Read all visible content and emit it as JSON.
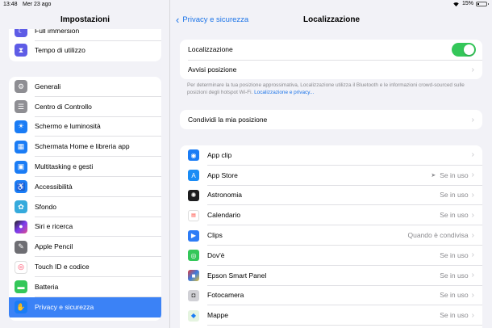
{
  "status_bar": {
    "time": "13:48",
    "date": "Mer 23 ago",
    "battery": "15%"
  },
  "sidebar": {
    "title": "Impostazioni",
    "top_items": [
      {
        "label": "Full immersion",
        "icon": "moon-icon",
        "color": "#5e5ce6"
      },
      {
        "label": "Tempo di utilizzo",
        "icon": "hourglass-icon",
        "color": "#5e5ce6"
      }
    ],
    "items": [
      {
        "label": "Generali",
        "icon": "gear-icon",
        "color": "#8e8e93"
      },
      {
        "label": "Centro di Controllo",
        "icon": "control-center-icon",
        "color": "#8e8e93"
      },
      {
        "label": "Schermo e luminosità",
        "icon": "brightness-icon",
        "color": "#1a7cf5"
      },
      {
        "label": "Schermata Home e libreria app",
        "icon": "home-screen-icon",
        "color": "#1a7cf5"
      },
      {
        "label": "Multitasking e gesti",
        "icon": "multitasking-icon",
        "color": "#1a7cf5"
      },
      {
        "label": "Accessibilità",
        "icon": "accessibility-icon",
        "color": "#1a7cf5"
      },
      {
        "label": "Sfondo",
        "icon": "wallpaper-icon",
        "color": "#35aadc"
      },
      {
        "label": "Siri e ricerca",
        "icon": "siri-icon",
        "color": "#222222"
      },
      {
        "label": "Apple Pencil",
        "icon": "pencil-icon",
        "color": "#6e6e73"
      },
      {
        "label": "Touch ID e codice",
        "icon": "fingerprint-icon",
        "color": "#ffffff"
      },
      {
        "label": "Batteria",
        "icon": "battery-icon",
        "color": "#34c759"
      },
      {
        "label": "Privacy e sicurezza",
        "icon": "hand-icon",
        "color": "#1a7cf5",
        "selected": true
      }
    ]
  },
  "detail": {
    "back_label": "Privacy e sicurezza",
    "title": "Localizzazione",
    "location_services_label": "Localizzazione",
    "location_services_on": true,
    "location_alerts_label": "Avvisi posizione",
    "footnote": "Per determinare la tua posizione approssimativa, Localizzazione utilizza il Bluetooth e le informazioni crowd-sourced sulle posizioni degli hotspot Wi-Fi. ",
    "footnote_link": "Localizzazione e privacy...",
    "share_location_label": "Condividi la mia posizione",
    "apps": [
      {
        "name": "App clip",
        "value": "",
        "icon": "app-clip-icon",
        "color": "#1a7cf5"
      },
      {
        "name": "App Store",
        "value": "Se in uso",
        "icon": "app-store-icon",
        "color": "#1a8cf5",
        "arrow": true
      },
      {
        "name": "Astronomia",
        "value": "Se in uso",
        "icon": "astronomy-icon",
        "color": "#1c1c1e"
      },
      {
        "name": "Calendario",
        "value": "Se in uso",
        "icon": "calendar-icon",
        "color": "#ffffff"
      },
      {
        "name": "Clips",
        "value": "Quando è condivisa",
        "icon": "clips-icon",
        "color": "#2d7cf6"
      },
      {
        "name": "Dov'è",
        "value": "Se in uso",
        "icon": "find-my-icon",
        "color": "#34c759"
      },
      {
        "name": "Epson Smart Panel",
        "value": "Se in uso",
        "icon": "epson-icon",
        "color": "#e8e8ea"
      },
      {
        "name": "Fotocamera",
        "value": "Se in uso",
        "icon": "camera-icon",
        "color": "#d1d1d6"
      },
      {
        "name": "Mappe",
        "value": "Se in uso",
        "icon": "maps-icon",
        "color": "#e5f4e0"
      }
    ]
  }
}
